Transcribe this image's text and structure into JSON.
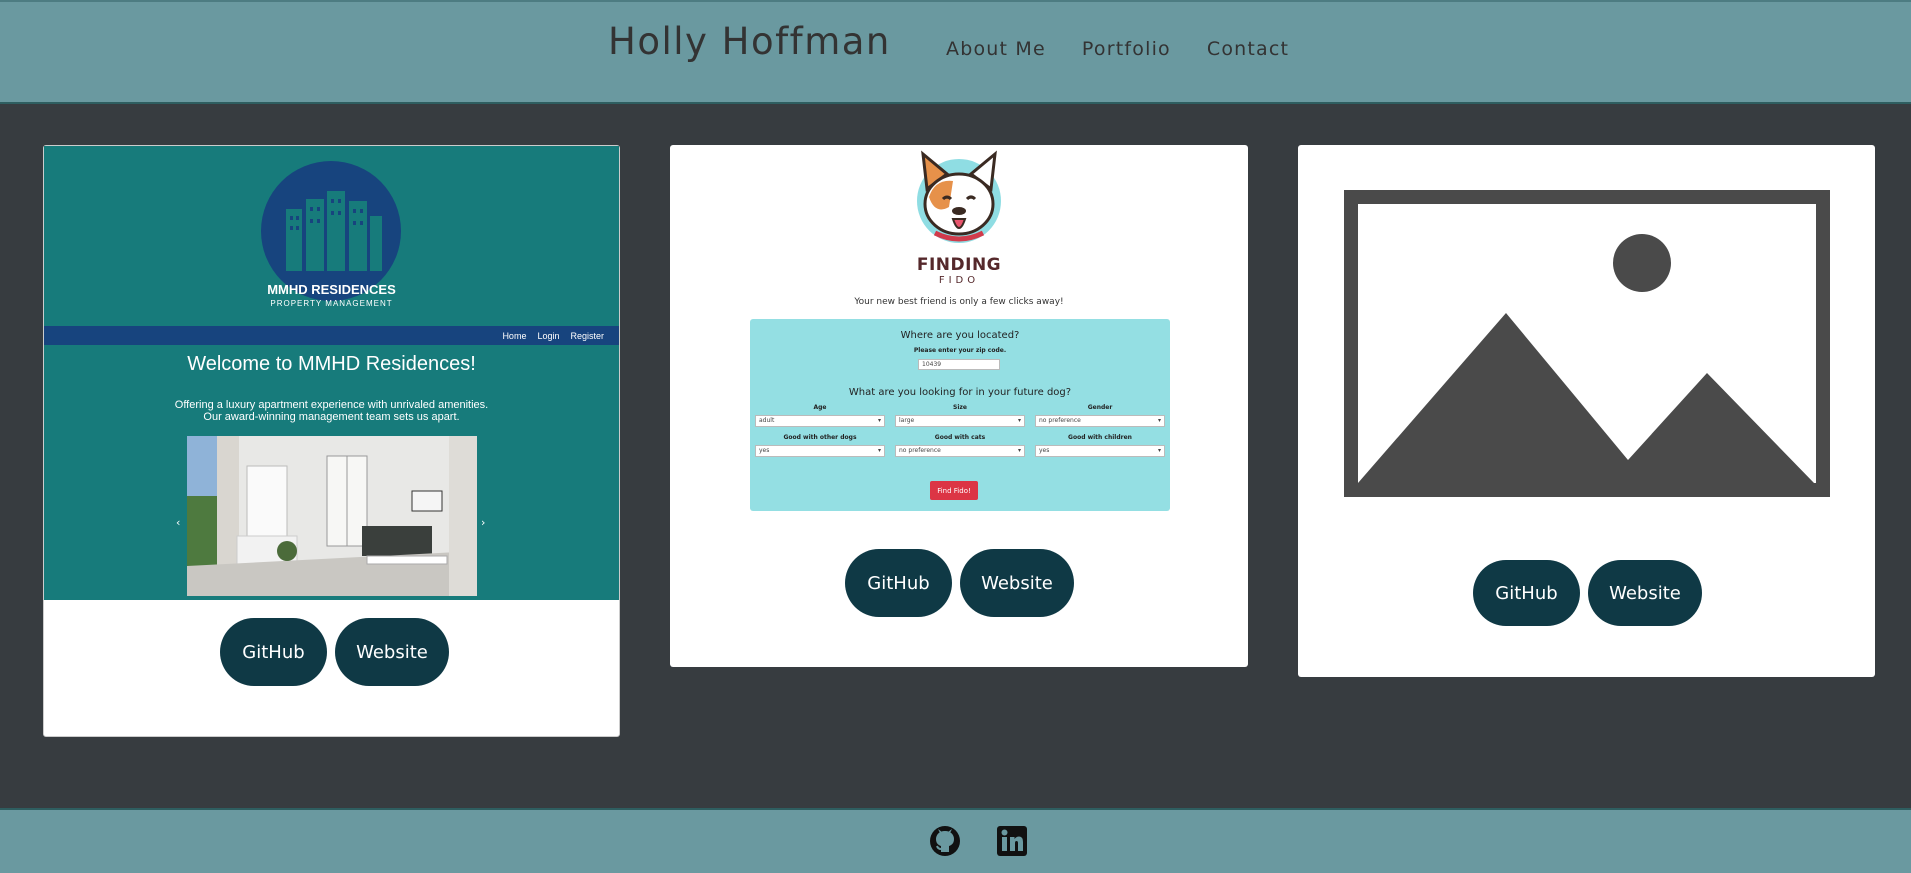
{
  "header": {
    "title": "Holly Hoffman",
    "nav": [
      "About Me",
      "Portfolio",
      "Contact"
    ]
  },
  "projects": [
    {
      "preview": {
        "brand": "MMHD RESIDENCES",
        "subtitle": "PROPERTY MANAGEMENT",
        "nav": [
          "Home",
          "Login",
          "Register"
        ],
        "heading": "Welcome to MMHD Residences!",
        "text_line1": "Offering a luxury apartment experience with unrivaled amenities.",
        "text_line2": "Our award-winning management team sets us apart.",
        "prev_arrow": "‹",
        "next_arrow": "›"
      },
      "github_label": "GitHub",
      "website_label": "Website"
    },
    {
      "preview": {
        "brand_line1": "FINDING",
        "brand_line2": "FIDO",
        "tagline": "Your new best friend is only a few clicks away!",
        "location_heading": "Where are you located?",
        "zip_prompt": "Please enter your zip code.",
        "zip_value": "10439",
        "looking_heading": "What are you looking for in your future dog?",
        "fields": [
          {
            "label": "Age",
            "value": "adult"
          },
          {
            "label": "Size",
            "value": "large"
          },
          {
            "label": "Gender",
            "value": "no preference"
          },
          {
            "label": "Good with other dogs",
            "value": "yes"
          },
          {
            "label": "Good with cats",
            "value": "no preference"
          },
          {
            "label": "Good with children",
            "value": "yes"
          }
        ],
        "submit_label": "Find Fido!"
      },
      "github_label": "GitHub",
      "website_label": "Website"
    },
    {
      "preview": {
        "icon": "image-placeholder-icon"
      },
      "github_label": "GitHub",
      "website_label": "Website"
    }
  ],
  "footer": {
    "icons": [
      "github-icon",
      "linkedin-icon"
    ]
  },
  "colors": {
    "header_bg": "#6a99a0",
    "page_bg": "#373c40",
    "button_bg": "#0f3945",
    "mmhd_teal": "#177b7b",
    "mmhd_navy": "#17447e",
    "fido_form_bg": "#94dfe3",
    "fido_button": "#dc3545"
  }
}
